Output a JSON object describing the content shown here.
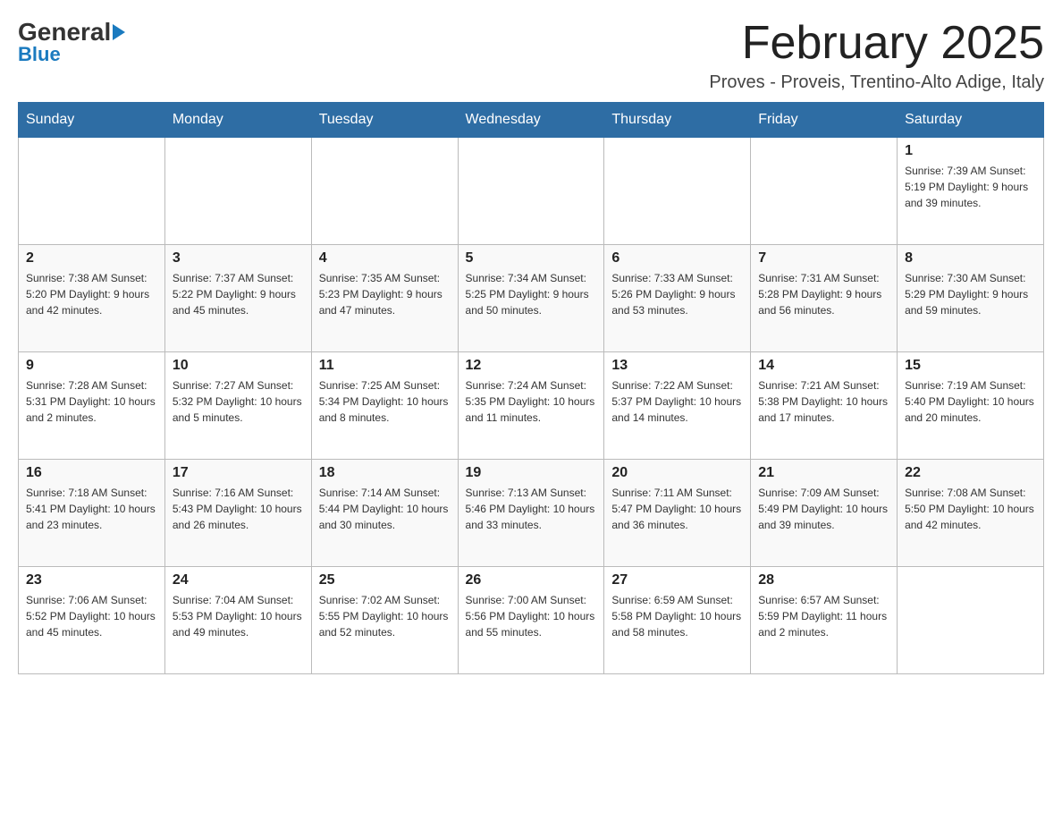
{
  "logo": {
    "part1": "General",
    "part2": "Blue"
  },
  "header": {
    "title": "February 2025",
    "location": "Proves - Proveis, Trentino-Alto Adige, Italy"
  },
  "weekdays": [
    "Sunday",
    "Monday",
    "Tuesday",
    "Wednesday",
    "Thursday",
    "Friday",
    "Saturday"
  ],
  "weeks": [
    [
      {
        "day": "",
        "info": ""
      },
      {
        "day": "",
        "info": ""
      },
      {
        "day": "",
        "info": ""
      },
      {
        "day": "",
        "info": ""
      },
      {
        "day": "",
        "info": ""
      },
      {
        "day": "",
        "info": ""
      },
      {
        "day": "1",
        "info": "Sunrise: 7:39 AM\nSunset: 5:19 PM\nDaylight: 9 hours and 39 minutes."
      }
    ],
    [
      {
        "day": "2",
        "info": "Sunrise: 7:38 AM\nSunset: 5:20 PM\nDaylight: 9 hours and 42 minutes."
      },
      {
        "day": "3",
        "info": "Sunrise: 7:37 AM\nSunset: 5:22 PM\nDaylight: 9 hours and 45 minutes."
      },
      {
        "day": "4",
        "info": "Sunrise: 7:35 AM\nSunset: 5:23 PM\nDaylight: 9 hours and 47 minutes."
      },
      {
        "day": "5",
        "info": "Sunrise: 7:34 AM\nSunset: 5:25 PM\nDaylight: 9 hours and 50 minutes."
      },
      {
        "day": "6",
        "info": "Sunrise: 7:33 AM\nSunset: 5:26 PM\nDaylight: 9 hours and 53 minutes."
      },
      {
        "day": "7",
        "info": "Sunrise: 7:31 AM\nSunset: 5:28 PM\nDaylight: 9 hours and 56 minutes."
      },
      {
        "day": "8",
        "info": "Sunrise: 7:30 AM\nSunset: 5:29 PM\nDaylight: 9 hours and 59 minutes."
      }
    ],
    [
      {
        "day": "9",
        "info": "Sunrise: 7:28 AM\nSunset: 5:31 PM\nDaylight: 10 hours and 2 minutes."
      },
      {
        "day": "10",
        "info": "Sunrise: 7:27 AM\nSunset: 5:32 PM\nDaylight: 10 hours and 5 minutes."
      },
      {
        "day": "11",
        "info": "Sunrise: 7:25 AM\nSunset: 5:34 PM\nDaylight: 10 hours and 8 minutes."
      },
      {
        "day": "12",
        "info": "Sunrise: 7:24 AM\nSunset: 5:35 PM\nDaylight: 10 hours and 11 minutes."
      },
      {
        "day": "13",
        "info": "Sunrise: 7:22 AM\nSunset: 5:37 PM\nDaylight: 10 hours and 14 minutes."
      },
      {
        "day": "14",
        "info": "Sunrise: 7:21 AM\nSunset: 5:38 PM\nDaylight: 10 hours and 17 minutes."
      },
      {
        "day": "15",
        "info": "Sunrise: 7:19 AM\nSunset: 5:40 PM\nDaylight: 10 hours and 20 minutes."
      }
    ],
    [
      {
        "day": "16",
        "info": "Sunrise: 7:18 AM\nSunset: 5:41 PM\nDaylight: 10 hours and 23 minutes."
      },
      {
        "day": "17",
        "info": "Sunrise: 7:16 AM\nSunset: 5:43 PM\nDaylight: 10 hours and 26 minutes."
      },
      {
        "day": "18",
        "info": "Sunrise: 7:14 AM\nSunset: 5:44 PM\nDaylight: 10 hours and 30 minutes."
      },
      {
        "day": "19",
        "info": "Sunrise: 7:13 AM\nSunset: 5:46 PM\nDaylight: 10 hours and 33 minutes."
      },
      {
        "day": "20",
        "info": "Sunrise: 7:11 AM\nSunset: 5:47 PM\nDaylight: 10 hours and 36 minutes."
      },
      {
        "day": "21",
        "info": "Sunrise: 7:09 AM\nSunset: 5:49 PM\nDaylight: 10 hours and 39 minutes."
      },
      {
        "day": "22",
        "info": "Sunrise: 7:08 AM\nSunset: 5:50 PM\nDaylight: 10 hours and 42 minutes."
      }
    ],
    [
      {
        "day": "23",
        "info": "Sunrise: 7:06 AM\nSunset: 5:52 PM\nDaylight: 10 hours and 45 minutes."
      },
      {
        "day": "24",
        "info": "Sunrise: 7:04 AM\nSunset: 5:53 PM\nDaylight: 10 hours and 49 minutes."
      },
      {
        "day": "25",
        "info": "Sunrise: 7:02 AM\nSunset: 5:55 PM\nDaylight: 10 hours and 52 minutes."
      },
      {
        "day": "26",
        "info": "Sunrise: 7:00 AM\nSunset: 5:56 PM\nDaylight: 10 hours and 55 minutes."
      },
      {
        "day": "27",
        "info": "Sunrise: 6:59 AM\nSunset: 5:58 PM\nDaylight: 10 hours and 58 minutes."
      },
      {
        "day": "28",
        "info": "Sunrise: 6:57 AM\nSunset: 5:59 PM\nDaylight: 11 hours and 2 minutes."
      },
      {
        "day": "",
        "info": ""
      }
    ]
  ]
}
